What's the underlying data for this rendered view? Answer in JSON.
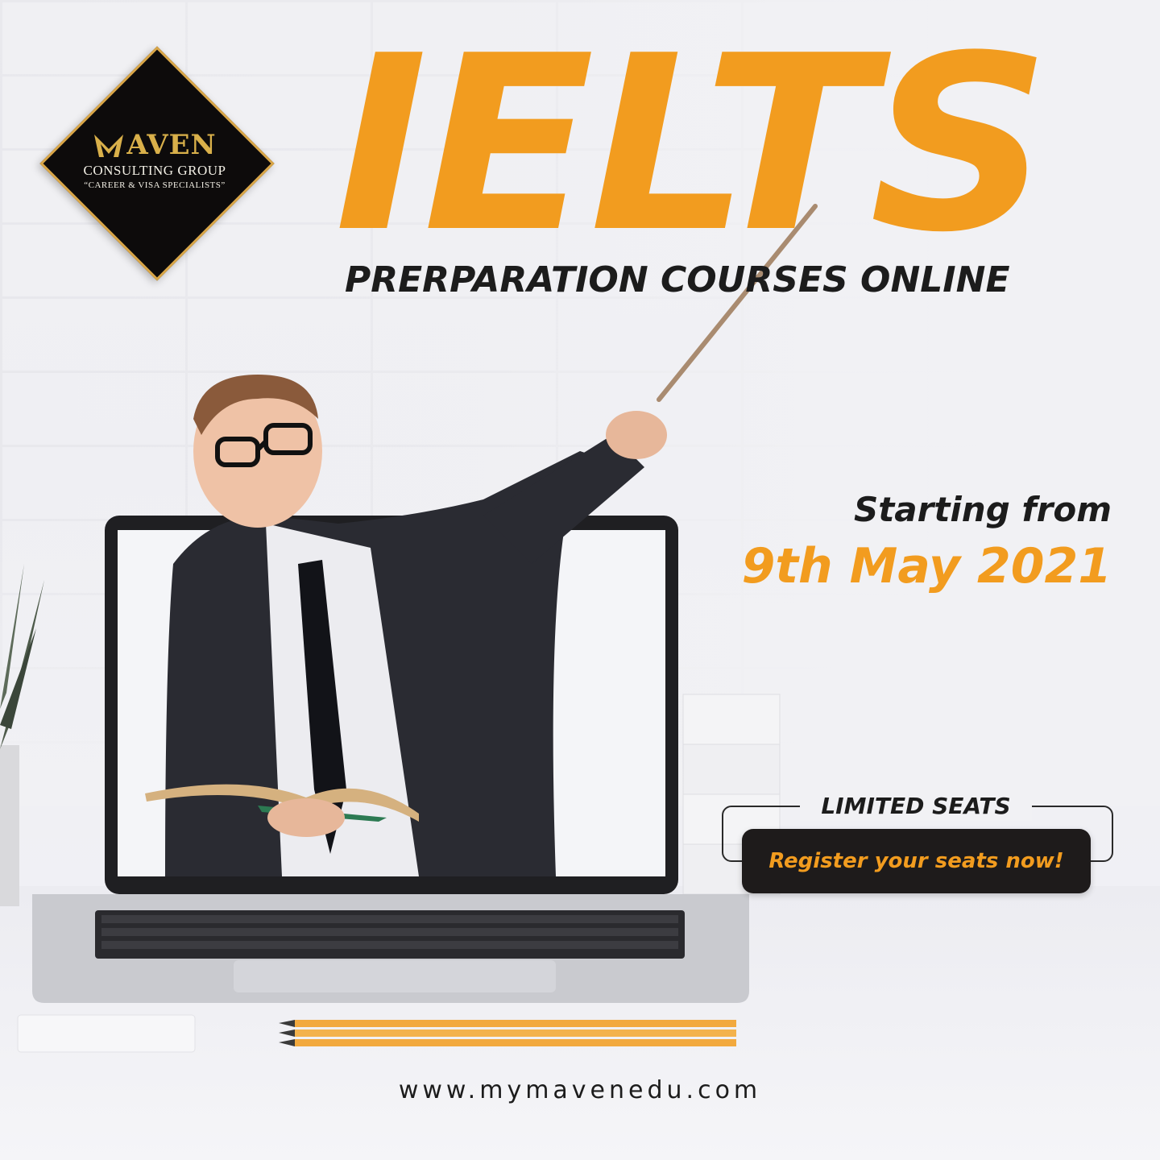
{
  "logo": {
    "brand": "AVEN",
    "subtitle": "CONSULTING GROUP",
    "tagline": "“CAREER & VISA SPECIALISTS”"
  },
  "headline": "IELTS",
  "subheadline": "PRERPARATION COURSES ONLINE",
  "start": {
    "label": "Starting from",
    "date": "9th May 2021"
  },
  "seats": {
    "label": "LIMITED SEATS",
    "cta": "Register your seats now!"
  },
  "website": "www.mymavenedu.com",
  "colors": {
    "accent": "#f29c1f",
    "dark": "#1c1c1c",
    "gold": "#d9b04a"
  },
  "icons": {
    "logo_mark": "m-wing-icon"
  }
}
